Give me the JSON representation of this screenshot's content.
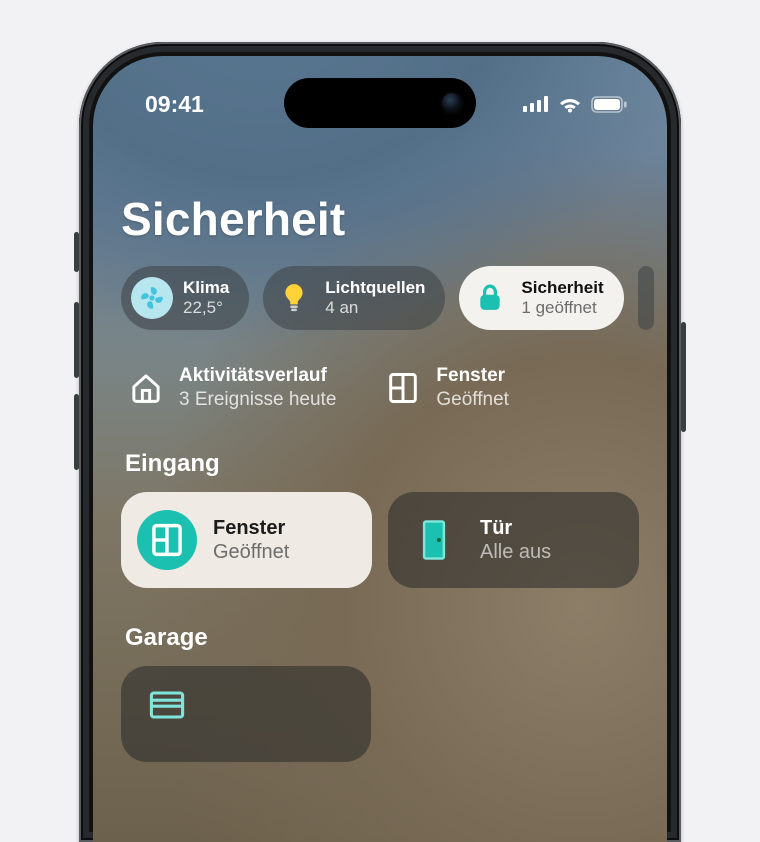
{
  "status": {
    "time": "09:41"
  },
  "page": {
    "title": "Sicherheit"
  },
  "pills": {
    "klima": {
      "label": "Klima",
      "value": "22,5°"
    },
    "licht": {
      "label": "Lichtquellen",
      "value": "4 an"
    },
    "sec": {
      "label": "Sicherheit",
      "value": "1 geöffnet"
    }
  },
  "info": {
    "activity": {
      "label": "Aktivitätsverlauf",
      "value": "3 Ereignisse heute"
    },
    "window": {
      "label": "Fenster",
      "value": "Geöffnet"
    }
  },
  "sections": {
    "eingang": {
      "title": "Eingang",
      "fenster": {
        "label": "Fenster",
        "value": "Geöffnet"
      },
      "tuer": {
        "label": "Tür",
        "value": "Alle aus"
      }
    },
    "garage": {
      "title": "Garage"
    }
  },
  "colors": {
    "accent_teal": "#1bc0b1",
    "light_teal": "#7fe4da",
    "bulb_yellow": "#ffd23a",
    "klima_bg": "#b7e6ef",
    "klima_fan": "#42c4df"
  }
}
